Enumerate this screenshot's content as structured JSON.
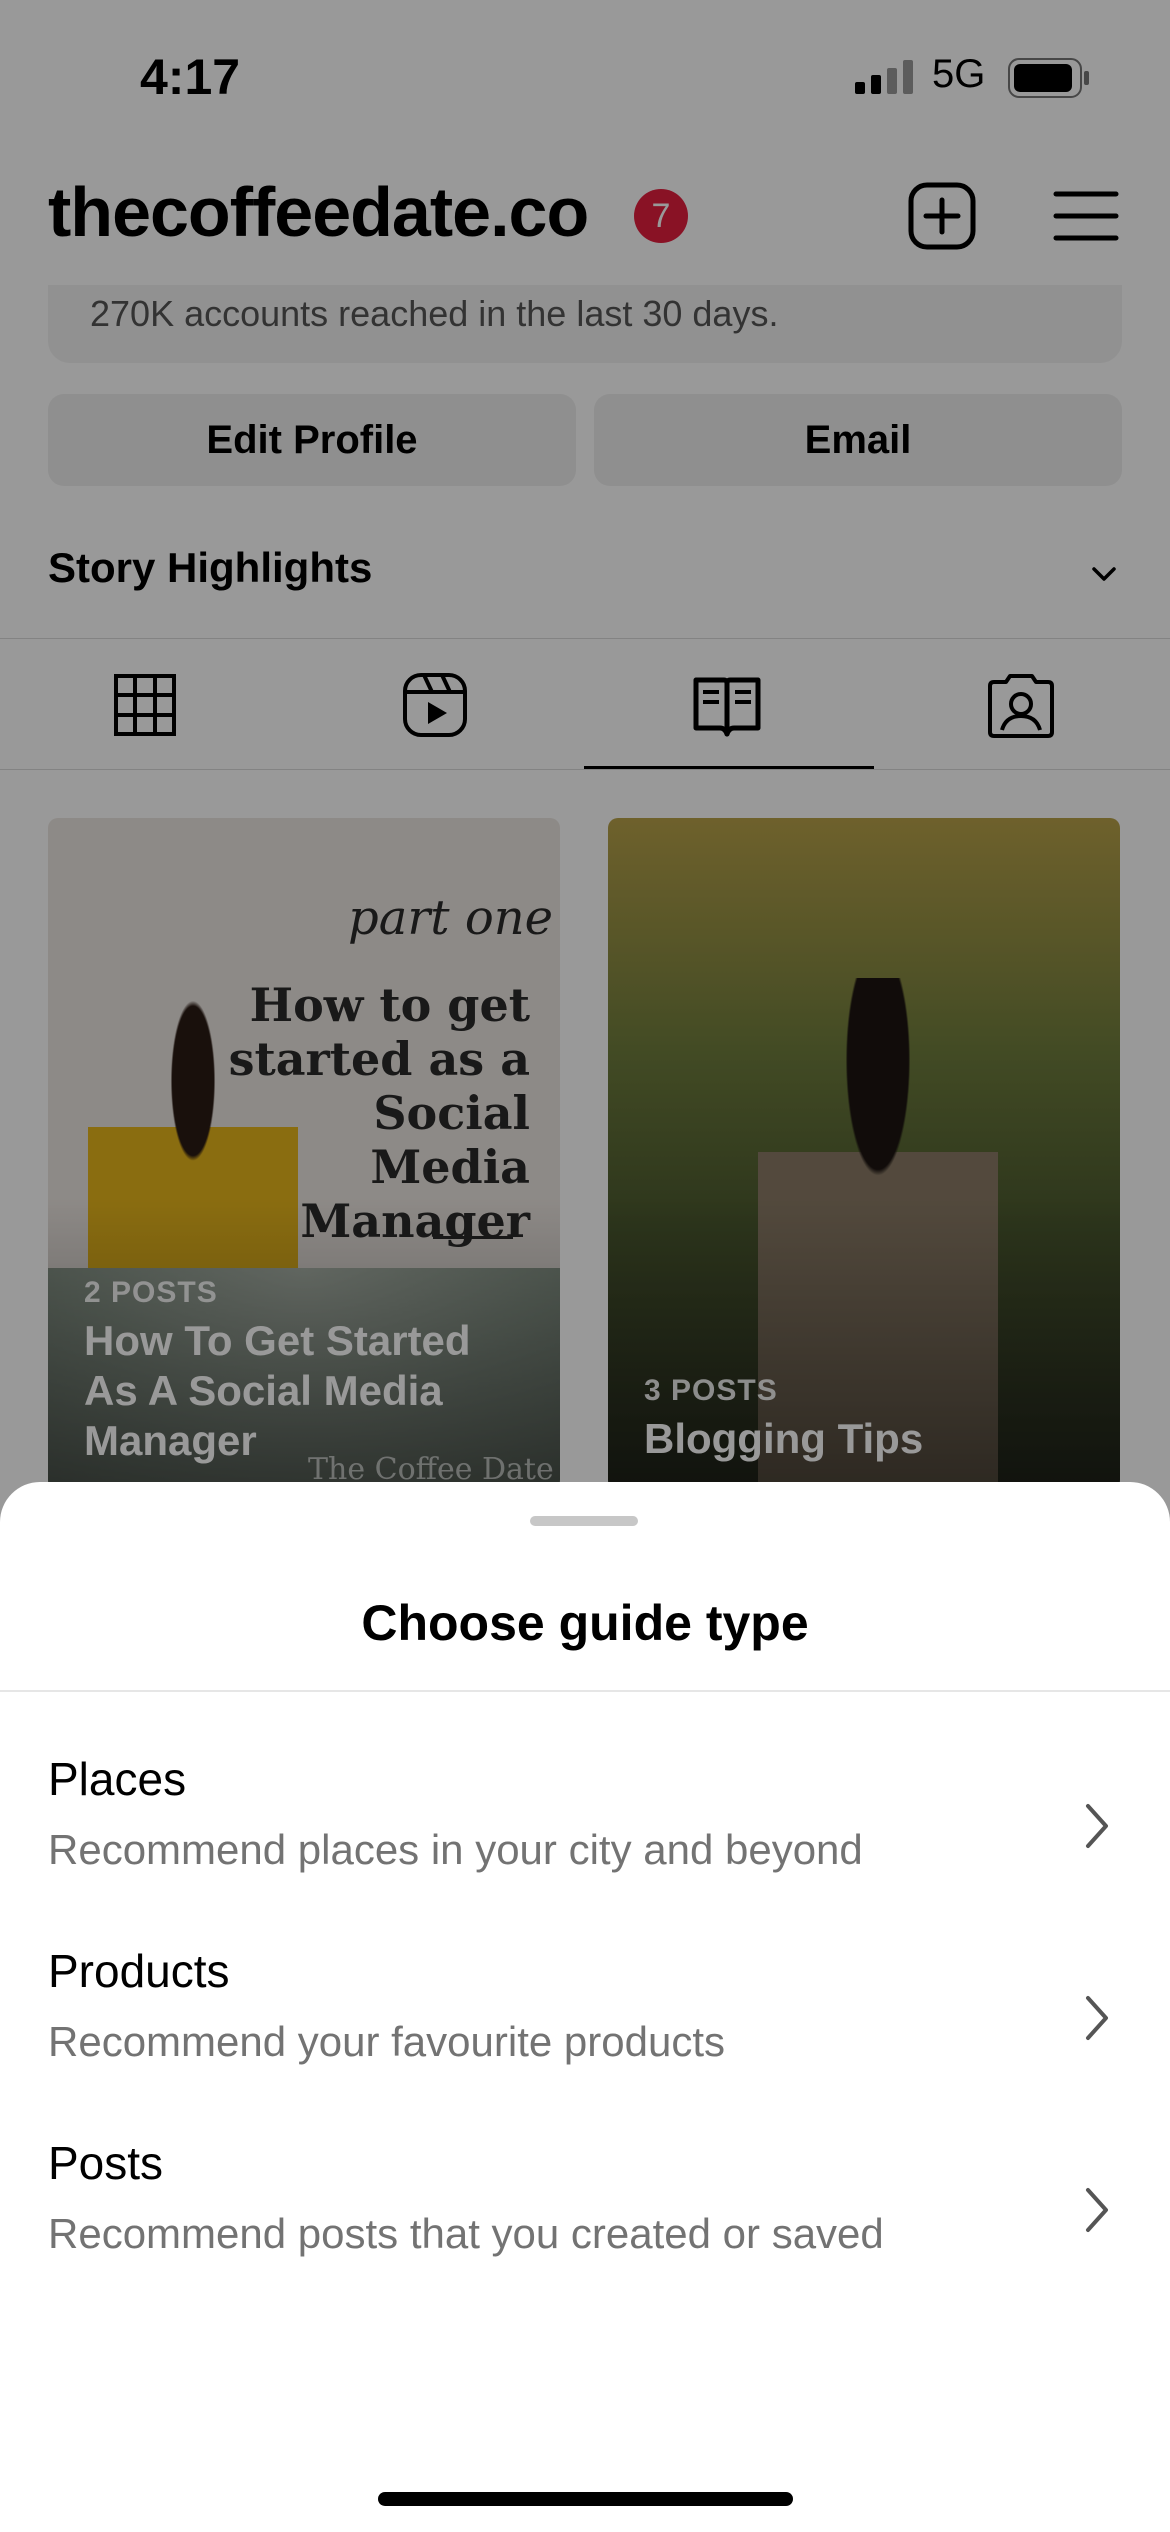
{
  "status_bar": {
    "time": "4:17",
    "network": "5G"
  },
  "header": {
    "username": "thecoffeedate.co",
    "badge_count": "7"
  },
  "insights": {
    "text": "270K accounts reached in the last 30 days."
  },
  "profile_actions": {
    "edit_profile": "Edit Profile",
    "email": "Email"
  },
  "story_highlights": {
    "label": "Story Highlights"
  },
  "tabs": [
    "grid-icon",
    "reels-icon",
    "guides-icon",
    "tagged-icon"
  ],
  "guides": [
    {
      "cover_script": "part one",
      "cover_headline": "How to get started as a Social Media Manager",
      "watermark": "The Coffee Date",
      "count": "2 POSTS",
      "title": "How To Get Started As A Social Media Manager"
    },
    {
      "count": "3 POSTS",
      "title": "Blogging Tips"
    }
  ],
  "sheet": {
    "title": "Choose guide type",
    "options": [
      {
        "title": "Places",
        "description": "Recommend places in your city and beyond"
      },
      {
        "title": "Products",
        "description": "Recommend your favourite products"
      },
      {
        "title": "Posts",
        "description": "Recommend posts that you created or saved"
      }
    ]
  },
  "colors": {
    "badge": "#e41e3f",
    "overlay": "rgba(0,0,0,0.40)",
    "secondary_text": "#737373"
  }
}
